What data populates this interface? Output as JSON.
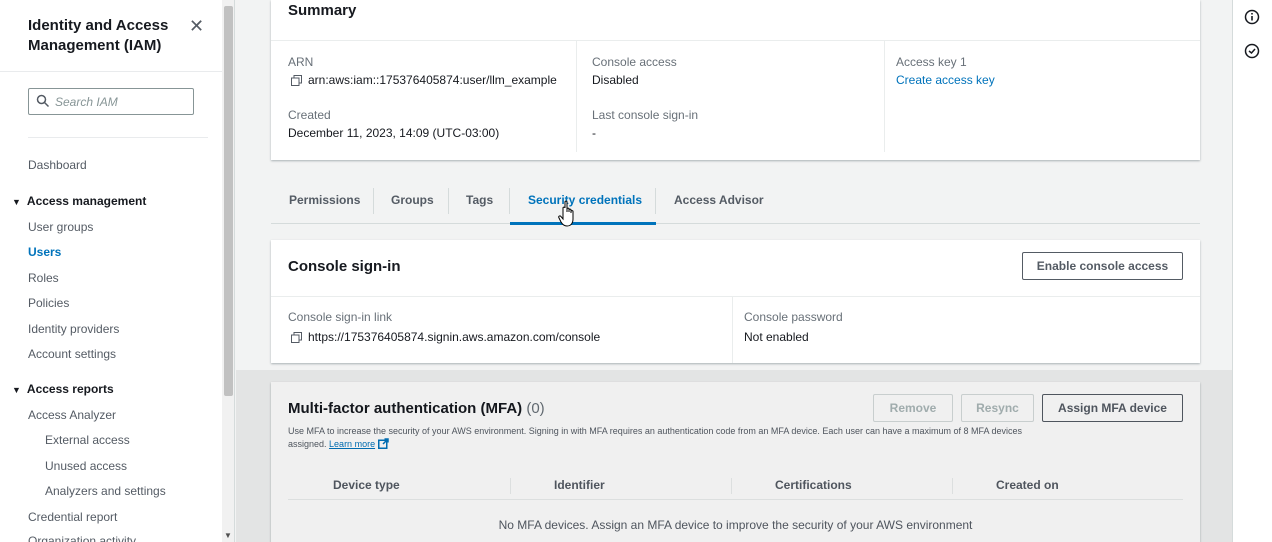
{
  "sidebar": {
    "title": "Identity and Access Management (IAM)",
    "search_placeholder": "Search IAM",
    "dashboard": "Dashboard",
    "access_management": {
      "label": "Access management",
      "items": [
        "User groups",
        "Users",
        "Roles",
        "Policies",
        "Identity providers",
        "Account settings"
      ],
      "active": "Users"
    },
    "access_reports": {
      "label": "Access reports",
      "items": [
        "Access Analyzer",
        "External access",
        "Unused access",
        "Analyzers and settings",
        "Credential report",
        "Organization activity"
      ]
    }
  },
  "summary": {
    "title": "Summary",
    "arn_label": "ARN",
    "arn_value": "arn:aws:iam::175376405874:user/llm_example",
    "created_label": "Created",
    "created_value": "December 11, 2023, 14:09 (UTC-03:00)",
    "console_access_label": "Console access",
    "console_access_value": "Disabled",
    "last_signin_label": "Last console sign-in",
    "last_signin_value": "-",
    "access_key_label": "Access key 1",
    "access_key_link": "Create access key"
  },
  "tabs": {
    "items": [
      "Permissions",
      "Groups",
      "Tags",
      "Security credentials",
      "Access Advisor"
    ],
    "active": "Security credentials"
  },
  "console_signin": {
    "title": "Console sign-in",
    "enable_button": "Enable console access",
    "link_label": "Console sign-in link",
    "link_value": "https://175376405874.signin.aws.amazon.com/console",
    "password_label": "Console password",
    "password_value": "Not enabled"
  },
  "mfa": {
    "title": "Multi-factor authentication (MFA)",
    "count": "(0)",
    "remove_button": "Remove",
    "resync_button": "Resync",
    "assign_button": "Assign MFA device",
    "description_line1": "Use MFA to increase the security of your AWS environment. Signing in with MFA requires an authentication code from an MFA device. Each user can have a maximum of 8 MFA devices",
    "description_line2": "assigned.",
    "learn_more": "Learn more",
    "columns": [
      "Device type",
      "Identifier",
      "Certifications",
      "Created on"
    ],
    "empty_message": "No MFA devices. Assign an MFA device to improve the security of your AWS environment"
  },
  "rail": {
    "icons": [
      "info-icon",
      "feedback-icon"
    ]
  }
}
